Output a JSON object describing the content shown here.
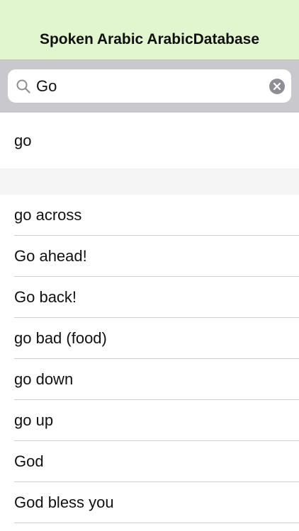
{
  "nav": {
    "title": "Spoken Arabic ArabicDatabase"
  },
  "search": {
    "value": "Go",
    "icon": "search-icon",
    "clear_icon": "clear-icon"
  },
  "results": {
    "top_item": {
      "label": "go"
    },
    "items": [
      {
        "label": "go across"
      },
      {
        "label": "Go ahead!"
      },
      {
        "label": "Go back!"
      },
      {
        "label": "go bad (food)"
      },
      {
        "label": "go down"
      },
      {
        "label": "go up"
      },
      {
        "label": "God"
      },
      {
        "label": "God bless you"
      }
    ]
  },
  "colors": {
    "nav_background": "#e1f6cf",
    "search_background": "#c8c8cd",
    "separator": "#d0d0d4"
  }
}
